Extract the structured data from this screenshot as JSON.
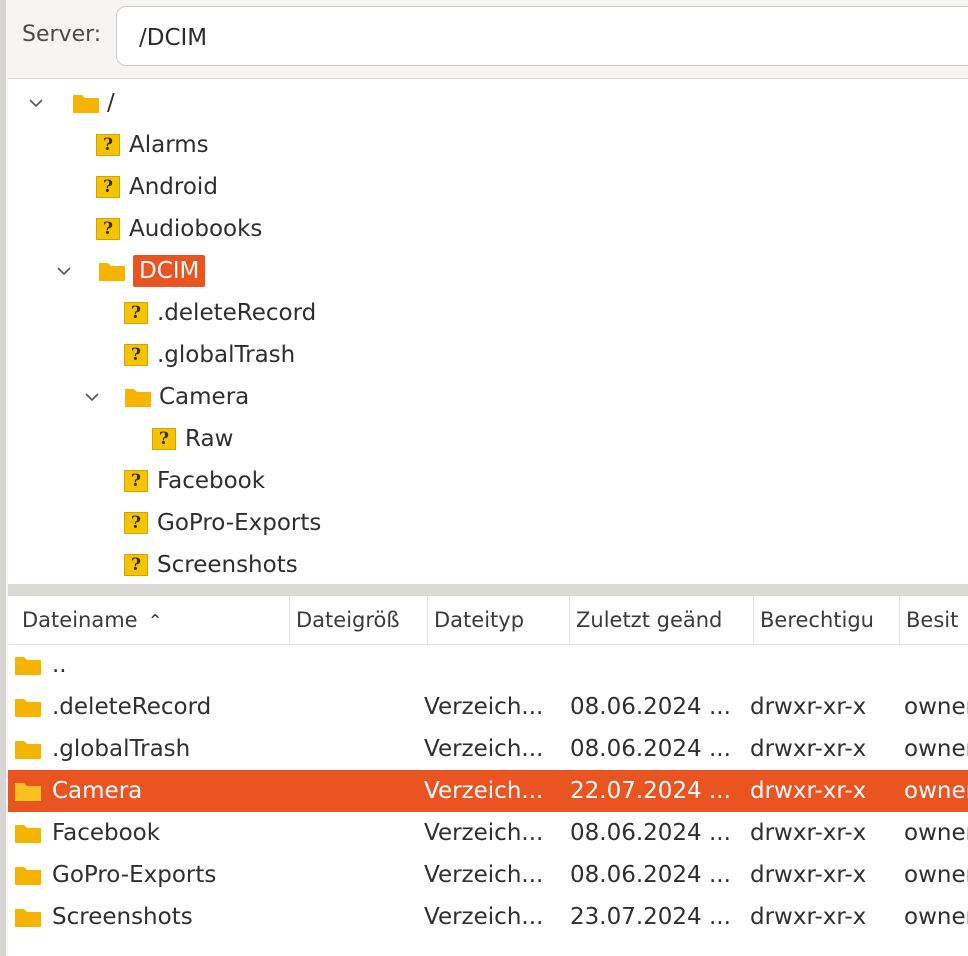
{
  "server": {
    "label": "Server:",
    "path": "/DCIM"
  },
  "tree": {
    "items": [
      {
        "label": "/",
        "type": "folder",
        "expanded": true
      },
      {
        "label": "Alarms",
        "type": "unknown"
      },
      {
        "label": "Android",
        "type": "unknown"
      },
      {
        "label": "Audiobooks",
        "type": "unknown"
      },
      {
        "label": "DCIM",
        "type": "folder",
        "expanded": true,
        "selected": true
      },
      {
        "label": ".deleteRecord",
        "type": "unknown"
      },
      {
        "label": ".globalTrash",
        "type": "unknown"
      },
      {
        "label": "Camera",
        "type": "folder",
        "expanded": true
      },
      {
        "label": "Raw",
        "type": "unknown"
      },
      {
        "label": "Facebook",
        "type": "unknown"
      },
      {
        "label": "GoPro-Exports",
        "type": "unknown"
      },
      {
        "label": "Screenshots",
        "type": "unknown"
      }
    ]
  },
  "list": {
    "columns": [
      "Dateiname",
      "Dateigröß",
      "Dateityp",
      "Zuletzt geänd",
      "Berechtigu",
      "Besit"
    ],
    "rows": [
      {
        "name": "..",
        "type": "",
        "modified": "",
        "perms": "",
        "owner": ""
      },
      {
        "name": ".deleteRecord",
        "type": "Verzeich...",
        "modified": "08.06.2024 ...",
        "perms": "drwxr-xr-x",
        "owner": "owner"
      },
      {
        "name": ".globalTrash",
        "type": "Verzeich...",
        "modified": "08.06.2024 ...",
        "perms": "drwxr-xr-x",
        "owner": "owner"
      },
      {
        "name": "Camera",
        "type": "Verzeich...",
        "modified": "22.07.2024 ...",
        "perms": "drwxr-xr-x",
        "owner": "owner",
        "selected": true
      },
      {
        "name": "Facebook",
        "type": "Verzeich...",
        "modified": "08.06.2024 ...",
        "perms": "drwxr-xr-x",
        "owner": "owner"
      },
      {
        "name": "GoPro-Exports",
        "type": "Verzeich...",
        "modified": "08.06.2024 ...",
        "perms": "drwxr-xr-x",
        "owner": "owner"
      },
      {
        "name": "Screenshots",
        "type": "Verzeich...",
        "modified": "23.07.2024 ...",
        "perms": "drwxr-xr-x",
        "owner": "owner"
      }
    ]
  },
  "colors": {
    "accent": "#e95420",
    "folder": "#f4b400",
    "unknown_icon": "#f5c400"
  }
}
